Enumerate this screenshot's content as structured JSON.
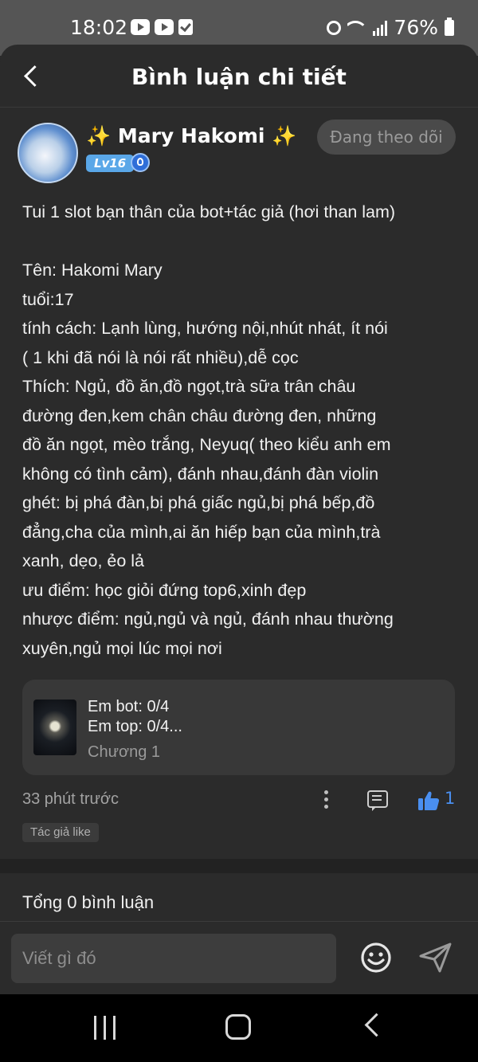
{
  "status_bar": {
    "time": "18:02",
    "battery": "76%"
  },
  "header": {
    "title": "Bình luận chi tiết"
  },
  "author": {
    "name": "✨ Mary Hakomi ✨",
    "level": "Lv16",
    "follow_label": "Đang theo dõi"
  },
  "comment": {
    "text": "Tui 1 slot bạn thân của bot+tác giả (hơi than lam)\n\nTên: Hakomi Mary\ntuổi:17\ntính cách: Lạnh lùng, hướng nội,nhút nhát, ít nói\n( 1 khi đã nói là nói rất nhiều),dễ cọc\nThích: Ngủ, đồ ăn,đồ ngọt,trà sữa trân châu\nđường đen,kem chân châu đường đen, những\nđồ ăn ngọt, mèo trắng, Neyuq( theo kiểu anh em\nkhông có tình cảm), đánh nhau,đánh đàn violin\nghét: bị phá đàn,bị phá giấc ngủ,bị phá bếp,đồ\nđẳng,cha của mình,ai ăn hiếp bạn của mình,trà\nxanh, dẹo, ẻo lả\nưu điểm: học giỏi đứng top6,xinh đẹp\nnhược điểm: ngủ,ngủ và ngủ, đánh nhau thường\nxuyên,ngủ mọi lúc mọi nơi",
    "time_ago": "33 phút trước",
    "like_count": "1",
    "author_liked": "Tác giả like"
  },
  "chapter": {
    "line1": "Em bot: 0/4",
    "line2": "Em top: 0/4...",
    "chapter_label": "Chương 1"
  },
  "replies": {
    "total_label": "Tổng 0 bình luận"
  },
  "composer": {
    "placeholder": "Viết gì đó"
  },
  "colors": {
    "accent_blue": "#4a8ff0",
    "background": "#2b2b2b"
  },
  "icons": [
    "back-icon",
    "more-icon",
    "reply-icon",
    "like-icon",
    "emoji-icon",
    "send-icon"
  ]
}
